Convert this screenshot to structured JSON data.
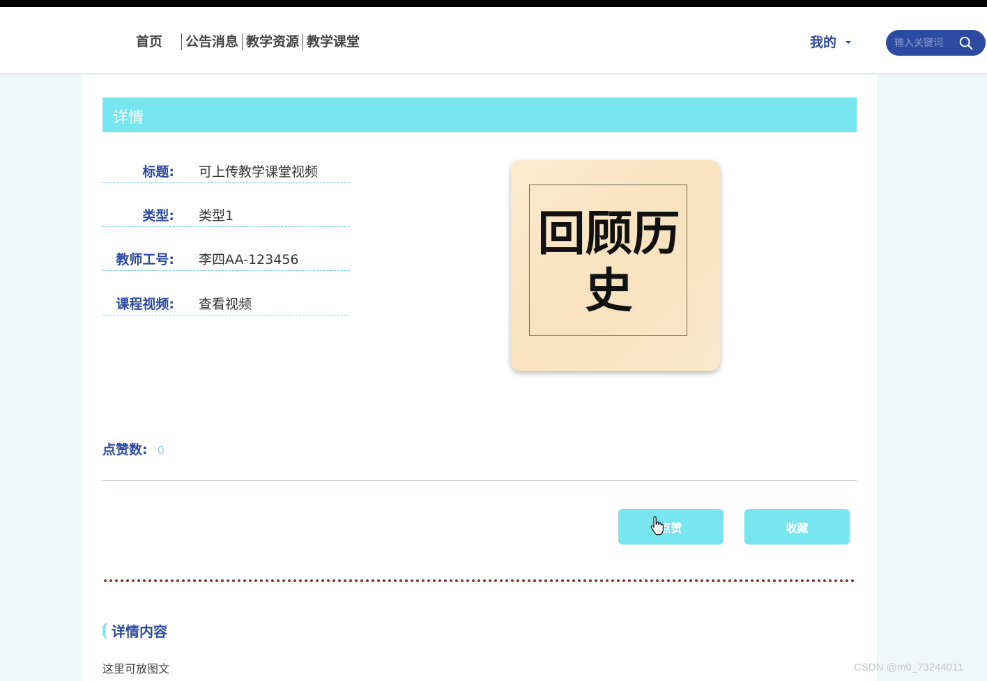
{
  "nav": {
    "items": [
      {
        "label": "首页"
      },
      {
        "label": "公告消息"
      },
      {
        "label": "教学资源"
      },
      {
        "label": "教学课堂"
      }
    ],
    "mine_label": "我的"
  },
  "search": {
    "placeholder": "输入关键词",
    "icon": "search-icon"
  },
  "detail": {
    "header": "详情",
    "fields": [
      {
        "label": "标题:",
        "value": "可上传教学课堂视频"
      },
      {
        "label": "类型:",
        "value": "类型1"
      },
      {
        "label": "教师工号:",
        "value": "李四AA-123456"
      },
      {
        "label": "课程视频:",
        "value": "查看视频"
      }
    ],
    "cover_text": "回顾历史"
  },
  "likes": {
    "label": "点赞数:",
    "count": "0"
  },
  "actions": {
    "like_label": "点赞",
    "favorite_label": "收藏"
  },
  "section": {
    "title": "详情内容",
    "body": "这里可放图文"
  },
  "watermark": "CSDN @m0_73244011",
  "colors": {
    "accent": "#78e6ee",
    "brand": "#2b4aa0"
  }
}
